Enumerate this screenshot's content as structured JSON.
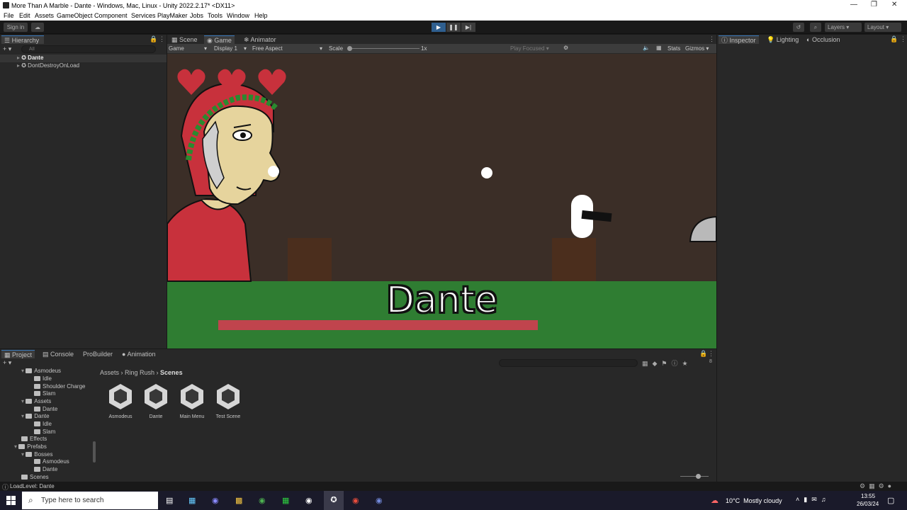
{
  "window": {
    "title": "More Than A Marble - Dante - Windows, Mac, Linux - Unity 2022.2.17* <DX11>"
  },
  "menu": [
    "File",
    "Edit",
    "Assets",
    "GameObject",
    "Component",
    "Services",
    "PlayMaker",
    "Jobs",
    "Tools",
    "Window",
    "Help"
  ],
  "toolbar": {
    "sign_in": "Sign in",
    "layers": "Layers",
    "layout": "Layout"
  },
  "hierarchy": {
    "tab": "Hierarchy",
    "search_placeholder": "All",
    "items": [
      "Dante",
      "DontDestroyOnLoad"
    ]
  },
  "game_view": {
    "tabs": [
      "Scene",
      "Game",
      "Animator"
    ],
    "controls": {
      "mode": "Game",
      "display": "Display 1",
      "aspect": "Free Aspect",
      "scale_label": "Scale",
      "scale_value": "1x",
      "play_focused": "Play Focused",
      "stats": "Stats",
      "gizmos": "Gizmos"
    },
    "boss_name": "Dante",
    "boss_health_fraction": 1.0,
    "hearts": 3,
    "colors": {
      "sky": "#3b2e27",
      "ground": "#2f7d32",
      "health": "#c0444d",
      "crate": "#4b2e1d"
    }
  },
  "inspector": {
    "tabs": [
      "Inspector",
      "Lighting",
      "Occlusion"
    ]
  },
  "project": {
    "tabs": [
      "Project",
      "Console",
      "ProBuilder",
      "Animation"
    ],
    "tree": [
      "Asmodeus",
      "Idle",
      "Shoulder Charge",
      "Slam",
      "Assets",
      "Dante",
      "Dante",
      "Idle",
      "Slam",
      "Effects",
      "Prefabs",
      "Bosses",
      "Asmodeus",
      "Dante",
      "Scenes"
    ],
    "breadcrumb": [
      "Assets",
      "Ring Rush",
      "Scenes"
    ],
    "assets": [
      "Asmodeus",
      "Dante",
      "Main Menu",
      "Test Scene"
    ],
    "hidden_count": "8"
  },
  "status": {
    "message": "LoadLevel: Dante"
  },
  "taskbar": {
    "search_placeholder": "Type here to search",
    "weather": "10°C  Mostly cloudy",
    "time": "13:55",
    "date": "26/03/24"
  }
}
